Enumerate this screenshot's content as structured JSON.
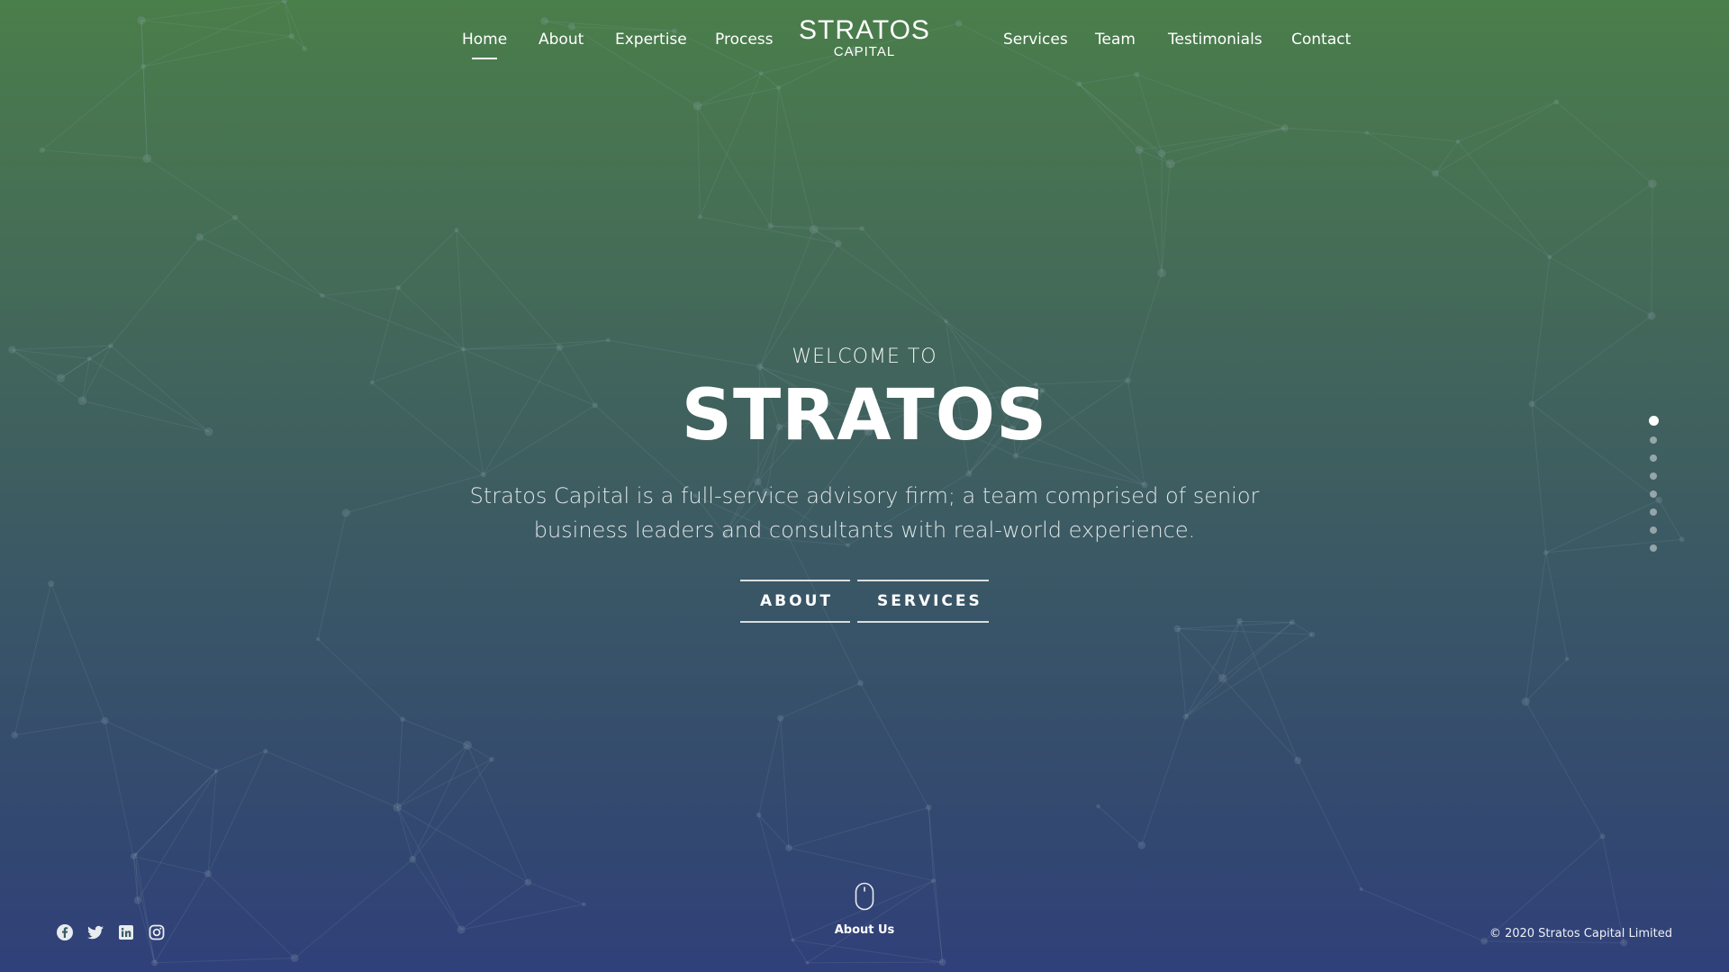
{
  "nav": {
    "left": [
      "Home",
      "About",
      "Expertise",
      "Process"
    ],
    "right": [
      "Services",
      "Team",
      "Testimonials",
      "Contact"
    ],
    "active": "Home"
  },
  "logo": {
    "main": "STRATOS",
    "sub": "CAPITAL"
  },
  "hero": {
    "kicker": "WELCOME TO",
    "title": "STRATOS",
    "description": "Stratos Capital is a full-service advisory firm; a team comprised of senior business leaders and consultants with real-world experience.",
    "buttons": {
      "about": "ABOUT",
      "services": "SERVICES"
    }
  },
  "page_dots": {
    "count": 8,
    "active_index": 0
  },
  "social": [
    "facebook-icon",
    "twitter-icon",
    "linkedin-icon",
    "instagram-icon"
  ],
  "scroll_hint": {
    "label": "About Us",
    "icon": "mouse-icon"
  },
  "footer": {
    "copyright": "© 2020 Stratos Capital Limited"
  },
  "colors": {
    "gradient_top": "#4a7e4a",
    "gradient_bottom": "#30407a",
    "text": "#ffffff",
    "network_lines": "#9fb0c0"
  }
}
